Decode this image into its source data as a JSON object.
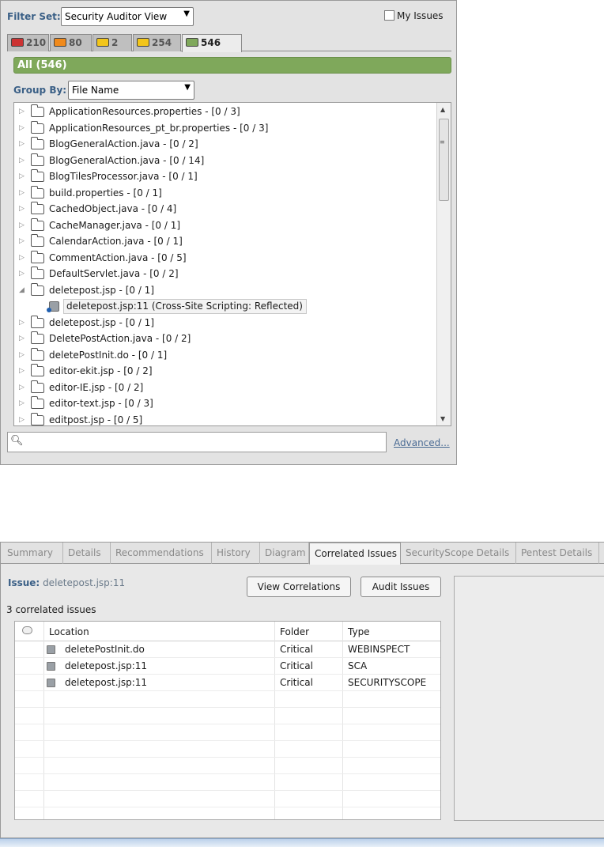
{
  "filter_bar": {
    "label": "Filter Set:",
    "selected": "Security Auditor View",
    "my_issues_label": "My Issues"
  },
  "severity_tabs": [
    {
      "count": "210",
      "color": "#cc3333"
    },
    {
      "count": "80",
      "color": "#f08a1c"
    },
    {
      "count": "2",
      "color": "#f2c51a"
    },
    {
      "count": "254",
      "color": "#f2c51a"
    },
    {
      "count": "546",
      "color": "#7fa85b"
    }
  ],
  "all_bar": {
    "label": "All (546)"
  },
  "group_by": {
    "label": "Group By:",
    "selected": "File Name"
  },
  "tree": [
    {
      "label": "ApplicationResources.properties - [0 / 3]"
    },
    {
      "label": "ApplicationResources_pt_br.properties - [0 / 3]"
    },
    {
      "label": "BlogGeneralAction.java - [0 / 2]"
    },
    {
      "label": "BlogGeneralAction.java - [0 / 14]"
    },
    {
      "label": "BlogTilesProcessor.java - [0 / 1]"
    },
    {
      "label": "build.properties - [0 / 1]"
    },
    {
      "label": "CachedObject.java - [0 / 4]"
    },
    {
      "label": "CacheManager.java - [0 / 1]"
    },
    {
      "label": "CalendarAction.java - [0 / 1]"
    },
    {
      "label": "CommentAction.java - [0 / 5]"
    },
    {
      "label": "DefaultServlet.java - [0 / 2]"
    },
    {
      "label": "deletepost.jsp - [0 / 1]",
      "expanded": true
    },
    {
      "label": "deletepost.jsp:11 (Cross-Site Scripting: Reflected)",
      "child": true
    },
    {
      "label": "deletepost.jsp - [0 / 1]"
    },
    {
      "label": "DeletePostAction.java - [0 / 2]"
    },
    {
      "label": "deletePostInit.do - [0 / 1]"
    },
    {
      "label": "editor-ekit.jsp - [0 / 2]"
    },
    {
      "label": "editor-IE.jsp - [0 / 2]"
    },
    {
      "label": "editor-text.jsp - [0 / 3]"
    },
    {
      "label": "editpost.jsp - [0 / 5]"
    }
  ],
  "search": {
    "advanced_label": "Advanced..."
  },
  "detail_tabs": [
    {
      "label": "Summary",
      "active": false
    },
    {
      "label": "Details",
      "active": false
    },
    {
      "label": "Recommendations",
      "active": false
    },
    {
      "label": "History",
      "active": false
    },
    {
      "label": "Diagram",
      "active": false
    },
    {
      "label": "Correlated Issues",
      "active": true
    },
    {
      "label": "SecurityScope Details",
      "active": false
    },
    {
      "label": "Pentest Details",
      "active": false
    }
  ],
  "issue": {
    "label": "Issue:",
    "value": "deletepost.jsp:11"
  },
  "buttons": {
    "view_correlations": "View Correlations",
    "audit_issues": "Audit Issues"
  },
  "correlated_count": "3 correlated issues",
  "table": {
    "headers": {
      "location": "Location",
      "folder": "Folder",
      "type": "Type"
    },
    "rows": [
      {
        "location": "deletePostInit.do",
        "folder": "Critical",
        "type": "WEBINSPECT"
      },
      {
        "location": "deletepost.jsp:11",
        "folder": "Critical",
        "type": "SCA"
      },
      {
        "location": "deletepost.jsp:11",
        "folder": "Critical",
        "type": "SECURITYSCOPE"
      }
    ]
  }
}
